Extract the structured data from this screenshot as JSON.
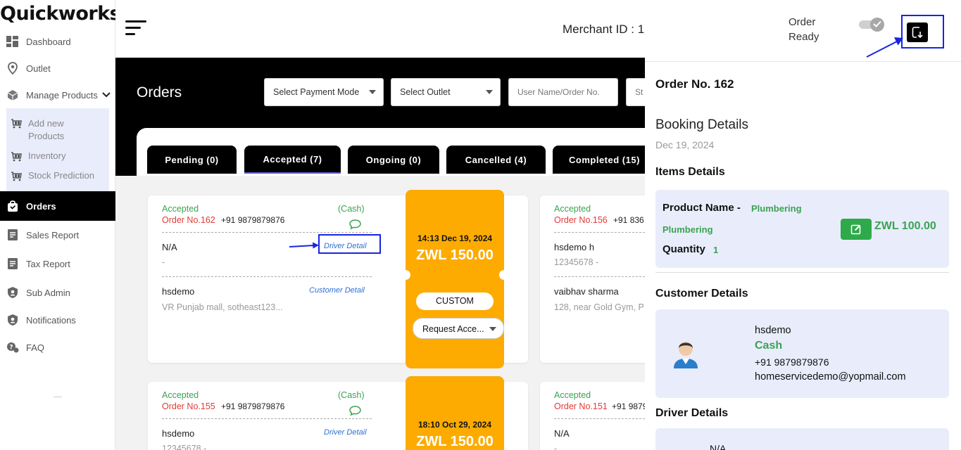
{
  "app": {
    "logo": "Quickworks"
  },
  "sidebar": {
    "items": [
      {
        "label": "Dashboard",
        "icon": "dashboard-icon"
      },
      {
        "label": "Outlet",
        "icon": "location-pin-icon"
      },
      {
        "label": "Manage Products",
        "icon": "box-icon"
      },
      {
        "label": "Orders",
        "icon": "shopping-bag-icon"
      },
      {
        "label": "Sales Report",
        "icon": "report-icon"
      },
      {
        "label": "Tax Report",
        "icon": "report-icon"
      },
      {
        "label": "Sub Admin",
        "icon": "shield-user-icon"
      },
      {
        "label": "Notifications",
        "icon": "shield-user-icon"
      },
      {
        "label": "FAQ",
        "icon": "faq-icon"
      }
    ],
    "submenu": [
      {
        "label": "Add new Products",
        "icon": "cart-icon"
      },
      {
        "label": "Inventory",
        "icon": "cart-icon"
      },
      {
        "label": "Stock Prediction",
        "icon": "cart-icon"
      }
    ]
  },
  "header": {
    "merchant": "Merchant ID : 1"
  },
  "orders": {
    "title": "Orders",
    "filters": {
      "payment_mode": "Select Payment Mode",
      "outlet": "Select Outlet",
      "search_placeholder": "User Name/Order No.",
      "extra": "St"
    },
    "tabs": [
      {
        "label": "Pending (0)"
      },
      {
        "label": "Accepted (7)"
      },
      {
        "label": "Ongoing (0)"
      },
      {
        "label": "Cancelled (4)"
      },
      {
        "label": "Completed (15)"
      }
    ],
    "cards": [
      {
        "status": "Accepted",
        "payment": "(Cash)",
        "order_no": "Order No.162",
        "phone": "+91 9879879876",
        "driver_name": "N/A",
        "driver_link": "Driver Detail",
        "driver_phone": "-",
        "customer_name": "hsdemo",
        "customer_link": "Customer Detail",
        "address": "VR Punjab mall, sotheast123...",
        "time": "14:13 Dec 19, 2024",
        "amount": "ZWL  150.00",
        "type": "CUSTOM",
        "action": "Request Acce..."
      },
      {
        "status": "Accepted",
        "payment": "(Cash)",
        "order_no": "Order No.155",
        "phone": "+91 9879879876",
        "driver_name": "hsdemo",
        "driver_link": "Driver Detail",
        "driver_phone": "12345678 -",
        "time": "18:10 Oct 29, 2024",
        "amount": "ZWL  150.00"
      }
    ],
    "side_cards": [
      {
        "status": "Accepted",
        "order_no": "Order No.156",
        "phone": "+91 836",
        "driver_name": "hsdemo h",
        "driver_phone": "12345678 -",
        "customer_name": "vaibhav sharma",
        "address": "128, near Gold Gym, P"
      },
      {
        "status": "Accepted",
        "order_no": "Order No.151",
        "phone": "+91 9879",
        "driver_name": "N/A",
        "driver_phone": "-"
      }
    ]
  },
  "drawer": {
    "order_ready": [
      "Order",
      "Ready"
    ],
    "order_title": "Order No. 162",
    "booking_title": "Booking Details",
    "booking_date": "Dec 19, 2024",
    "items_title": "Items Details",
    "product_label": "Product Name -",
    "product_name_1": "Plumbering",
    "product_name_2": "Plumbering",
    "quantity_label": "Quantity",
    "quantity_value": "1",
    "price": "ZWL 100.00",
    "customer_title": "Customer Details",
    "customer": {
      "name": "hsdemo",
      "payment": "Cash",
      "phone": "+91 9879879876",
      "email": "homeservicedemo@yopmail.com"
    },
    "driver_title": "Driver Details",
    "driver_name": "N/A"
  },
  "colors": {
    "accent_green": "#3aa352",
    "ticket_orange": "#fdab00",
    "highlight_blue": "#1726e0",
    "order_red": "#e53935"
  }
}
